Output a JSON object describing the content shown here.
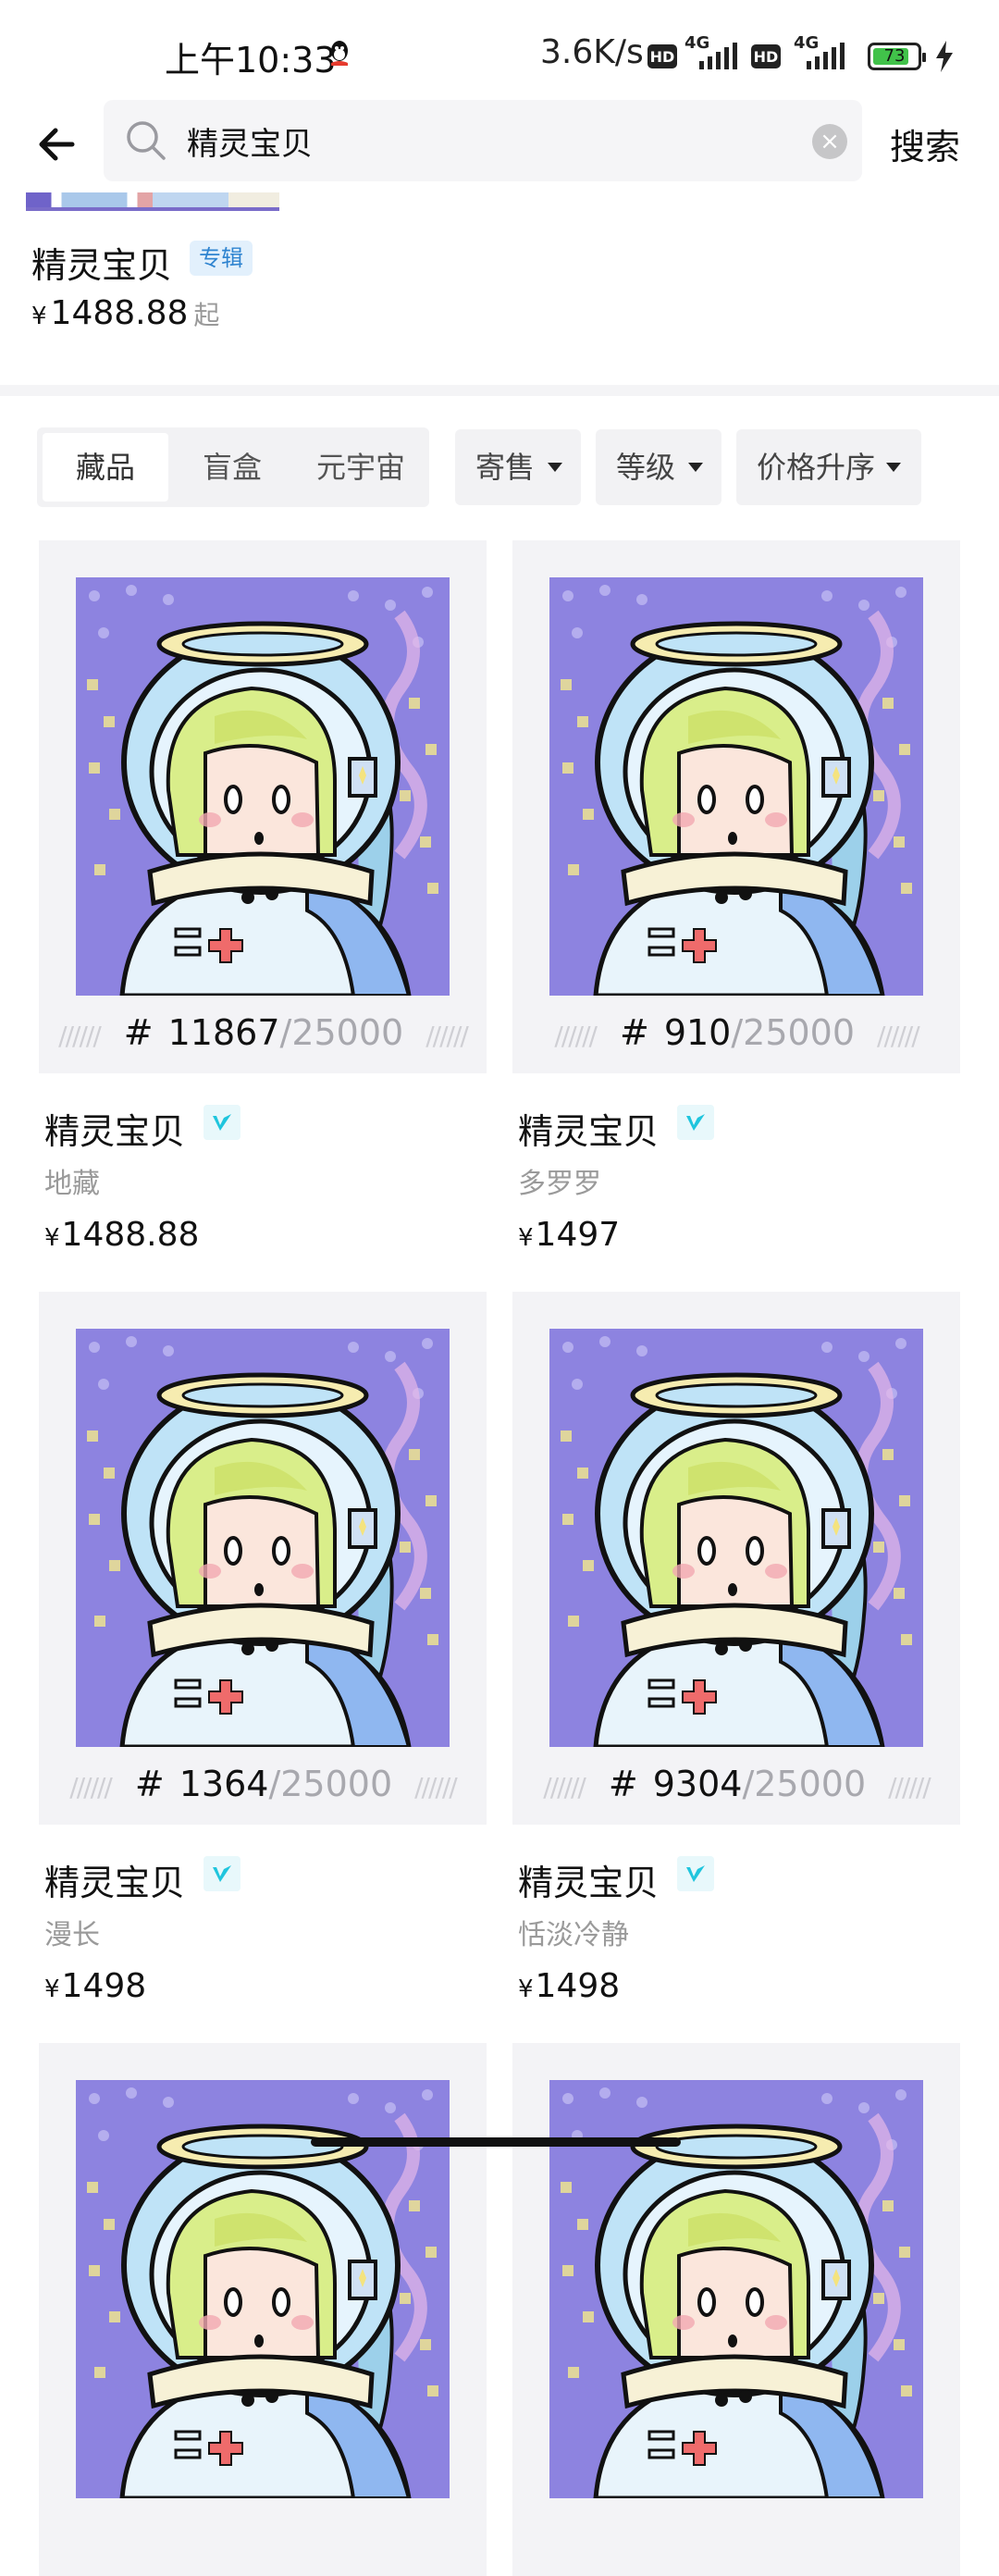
{
  "status_bar": {
    "time": "上午10:33",
    "speed": "3.6K/s",
    "hd1": "HD",
    "net1": "4G",
    "hd2": "HD",
    "net2": "4G",
    "battery": "73"
  },
  "search": {
    "query": "精灵宝贝",
    "button_label": "搜索"
  },
  "album": {
    "title": "精灵宝贝",
    "tag": "专辑",
    "currency": "¥",
    "price": "1488.88",
    "price_suffix": "起"
  },
  "tabs": [
    {
      "label": "藏品",
      "active": true
    },
    {
      "label": "盲盒",
      "active": false
    },
    {
      "label": "元宇宙",
      "active": false
    }
  ],
  "filters": [
    {
      "label": "寄售"
    },
    {
      "label": "等级"
    },
    {
      "label": "价格升序"
    }
  ],
  "items": [
    {
      "serial_prefix": "#",
      "serial": "11867",
      "total": "/25000",
      "name": "精灵宝贝",
      "owner": "地藏",
      "currency": "¥",
      "price": "1488.88"
    },
    {
      "serial_prefix": "#",
      "serial": "910",
      "total": "/25000",
      "name": "精灵宝贝",
      "owner": "多罗罗",
      "currency": "¥",
      "price": "1497"
    },
    {
      "serial_prefix": "#",
      "serial": "1364",
      "total": "/25000",
      "name": "精灵宝贝",
      "owner": "漫长",
      "currency": "¥",
      "price": "1498"
    },
    {
      "serial_prefix": "#",
      "serial": "9304",
      "total": "/25000",
      "name": "精灵宝贝",
      "owner": "恬淡冷静",
      "currency": "¥",
      "price": "1498"
    }
  ],
  "colors": {
    "tag_bg": "#e2f0fc",
    "tag_text": "#2f84d0",
    "art_bg": "#8d83e0",
    "badge_accent": "#1fc5dd"
  }
}
